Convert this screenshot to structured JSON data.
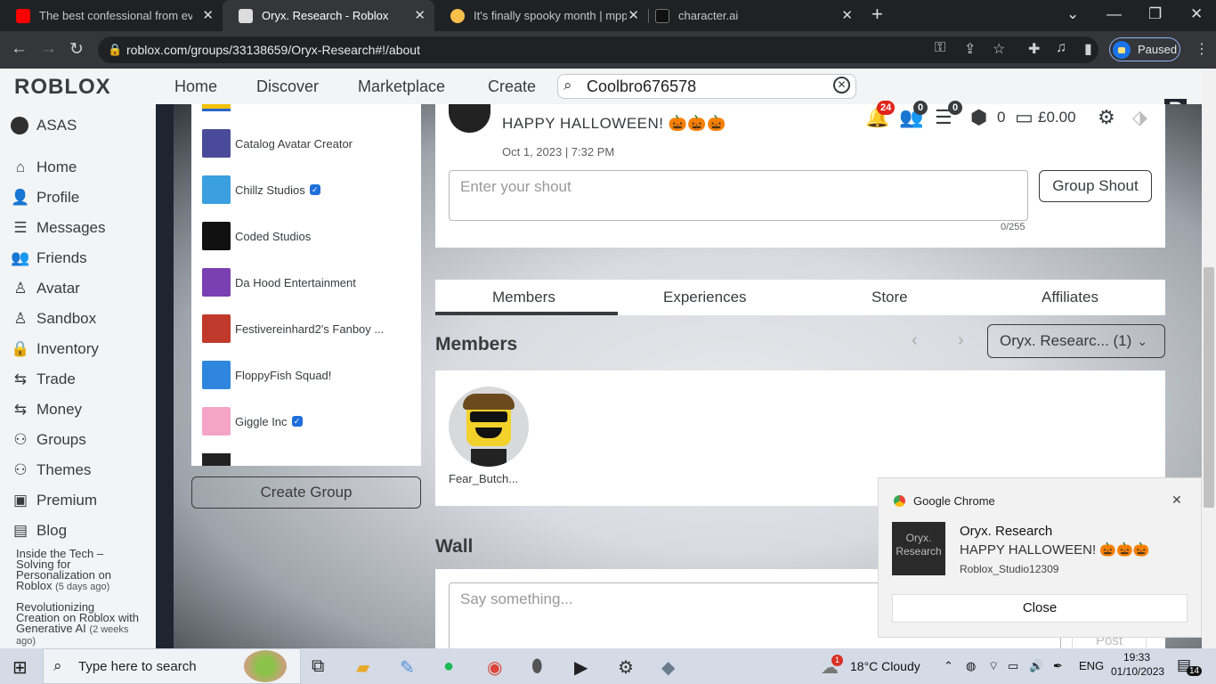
{
  "browser": {
    "tabs": [
      {
        "title": "The best confessional from every",
        "favicon_color": "#ff0000",
        "icon": "youtube-icon"
      },
      {
        "title": "Oryx. Research - Roblox",
        "favicon_color": "#dddddd",
        "icon": "roblox-icon"
      },
      {
        "title": "It's finally spooky month | mpp.c",
        "favicon_color": "#f7c04a",
        "icon": "music-note-icon"
      },
      {
        "title": "character.ai",
        "favicon_color": "#111111",
        "icon": "cai-icon"
      }
    ],
    "url": "roblox.com/groups/33138659/Oryx-Research#!/about",
    "profile_label": "Paused"
  },
  "roblox_header": {
    "logo": "RΟBLOX",
    "nav": [
      "Home",
      "Discover",
      "Marketplace",
      "Create"
    ],
    "search_value": "Coolbro676578",
    "notifications_count": "24",
    "friends_count": "0",
    "messages_count": "0",
    "robux": "0",
    "balance": "£0.00"
  },
  "sidebar": {
    "username": "ASAS",
    "items": [
      {
        "label": "Home",
        "icon": "home-icon",
        "glyph": "⌂"
      },
      {
        "label": "Profile",
        "icon": "profile-icon",
        "glyph": "👤"
      },
      {
        "label": "Messages",
        "icon": "messages-icon",
        "glyph": "☰"
      },
      {
        "label": "Friends",
        "icon": "friends-icon",
        "glyph": "👥"
      },
      {
        "label": "Avatar",
        "icon": "avatar-icon",
        "glyph": "♙"
      },
      {
        "label": "Sandbox",
        "icon": "sandbox-icon",
        "glyph": "♙"
      },
      {
        "label": "Inventory",
        "icon": "inventory-icon",
        "glyph": "🔒"
      },
      {
        "label": "Trade",
        "icon": "trade-icon",
        "glyph": "⇆"
      },
      {
        "label": "Money",
        "icon": "money-icon",
        "glyph": "⇆"
      },
      {
        "label": "Groups",
        "icon": "groups-icon",
        "glyph": "⚇"
      },
      {
        "label": "Themes",
        "icon": "themes-icon",
        "glyph": "⚇"
      },
      {
        "label": "Premium",
        "icon": "premium-icon",
        "glyph": "▣"
      },
      {
        "label": "Blog",
        "icon": "blog-icon",
        "glyph": "▤"
      }
    ],
    "blog_posts": [
      {
        "title": "Inside the Tech – Solving for Personalization on Roblox",
        "age": "(5 days ago)"
      },
      {
        "title": "Revolutionizing Creation on Roblox with Generative AI",
        "age": "(2 weeks ago)"
      }
    ]
  },
  "groups_list": {
    "items": [
      {
        "name": "Catalog Avatar Creator",
        "verified": false,
        "color": "#4a4a9a"
      },
      {
        "name": "Chillz Studios",
        "verified": true,
        "color": "#3aa0e0"
      },
      {
        "name": "Coded Studios",
        "verified": false,
        "color": "#111111"
      },
      {
        "name": "Da Hood Entertainment",
        "verified": false,
        "color": "#7a3fb0"
      },
      {
        "name": "Festivereinhard2's Fanboy ...",
        "verified": false,
        "color": "#c0392b"
      },
      {
        "name": "FloppyFish Squad!",
        "verified": false,
        "color": "#2e86de"
      },
      {
        "name": "Giggle Inc",
        "verified": true,
        "color": "#f5a3c7"
      }
    ],
    "create_button": "Create Group"
  },
  "shout": {
    "text": "HAPPY HALLOWEEN! 🎃🎃🎃",
    "date": "Oct 1, 2023 | 7:32 PM",
    "placeholder": "Enter your shout",
    "char_count": "0/255",
    "button": "Group Shout"
  },
  "group_tabs": [
    "Members",
    "Experiences",
    "Store",
    "Affiliates"
  ],
  "members": {
    "heading": "Members",
    "role_select": "Oryx. Researc... (1)",
    "list": [
      {
        "name": "Fear_Butch..."
      }
    ]
  },
  "wall": {
    "heading": "Wall",
    "placeholder": "Say something...",
    "post_button": "Post"
  },
  "notification": {
    "app": "Google Chrome",
    "image_text": "Oryx. Research",
    "title": "Oryx. Research",
    "message": "HAPPY HALLOWEEN! 🎃🎃🎃",
    "source": "Roblox_Studio12309",
    "close_button": "Close"
  },
  "taskbar": {
    "search_placeholder": "Type here to search",
    "weather": "18°C  Cloudy",
    "weather_badge": "1",
    "language": "ENG",
    "time": "19:33",
    "date": "01/10/2023",
    "notifications": "14"
  }
}
